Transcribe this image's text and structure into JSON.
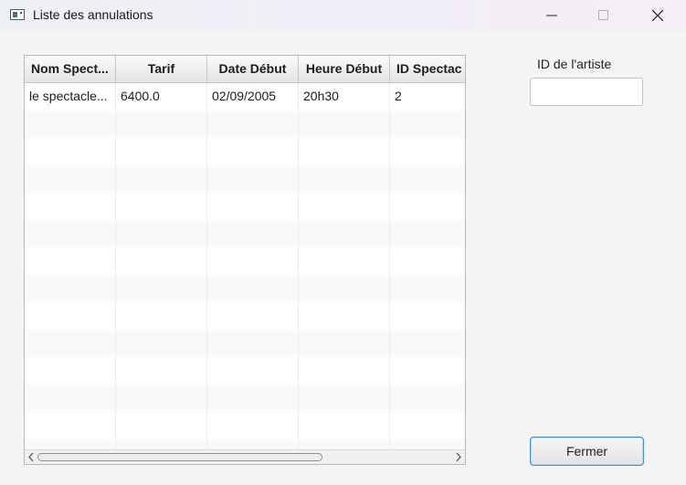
{
  "window": {
    "title": "Liste des annulations",
    "controls": {
      "minimize": "minimize-icon",
      "maximize": "maximize-icon",
      "close": "close-icon"
    }
  },
  "table": {
    "columns": [
      "Nom Spect...",
      "Tarif",
      "Date Début",
      "Heure Début",
      "ID Spectac"
    ],
    "rows": [
      [
        "le spectacle...",
        "6400.0",
        "02/09/2005",
        "20h30",
        "2"
      ]
    ],
    "empty_row_count": 13
  },
  "artist": {
    "label": "ID de l'artiste",
    "value": "",
    "placeholder": ""
  },
  "actions": {
    "close_label": "Fermer"
  },
  "colors": {
    "focus_border": "#3d8fd6",
    "titlebar": "#eef0f6"
  }
}
